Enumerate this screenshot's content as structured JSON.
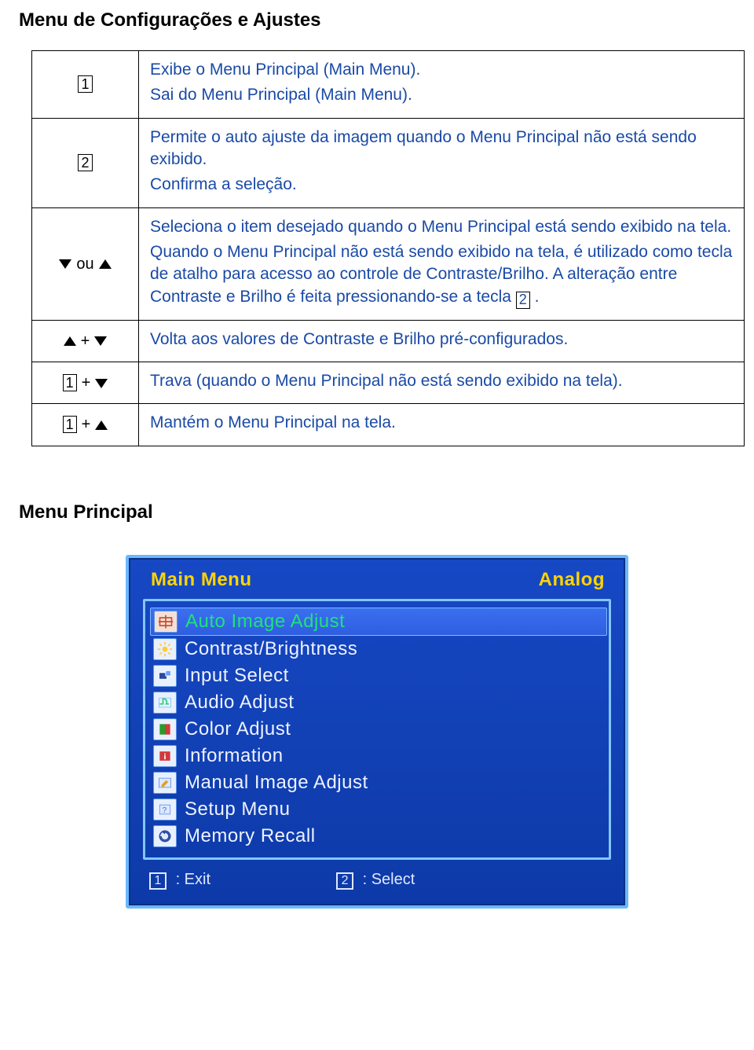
{
  "headings": {
    "config_menu": "Menu de Configurações e Ajustes",
    "main_menu": "Menu Principal"
  },
  "keytable": {
    "rows": [
      {
        "key_kind": "box",
        "key": "1",
        "lines": [
          "Exibe o Menu Principal (Main Menu).",
          "Sai do Menu Principal (Main Menu)."
        ]
      },
      {
        "key_kind": "box",
        "key": "2",
        "lines": [
          "Permite o auto ajuste da imagem quando o Menu Principal não está sendo exibido.",
          "Confirma a seleção."
        ]
      },
      {
        "key_kind": "down_ou_up",
        "ou_label": "ou",
        "lines": [
          "Seleciona o item desejado quando o Menu Principal está sendo exibido na tela.",
          "Quando o Menu Principal não está sendo exibido na tela, é utilizado como tecla de atalho para acesso ao controle de Contraste/Brilho. A alteração entre Contraste e Brilho é feita pressionando-se a tecla "
        ],
        "inline_key_after": "2",
        "inline_tail": " ."
      },
      {
        "key_kind": "up_plus_down",
        "lines": [
          "Volta aos valores de Contraste e Brilho pré-configurados."
        ]
      },
      {
        "key_kind": "box_plus_down",
        "key": "1",
        "lines": [
          "Trava (quando o Menu Principal não está sendo exibido na tela)."
        ]
      },
      {
        "key_kind": "box_plus_up",
        "key": "1",
        "lines": [
          "Mantém o Menu Principal na tela."
        ]
      }
    ]
  },
  "osd": {
    "header_left": "Main Menu",
    "header_right": "Analog",
    "items": [
      {
        "label": "Auto Image Adjust",
        "icon": "auto-image-icon",
        "selected": true
      },
      {
        "label": "Contrast/Brightness",
        "icon": "brightness-icon",
        "selected": false
      },
      {
        "label": "Input Select",
        "icon": "input-icon",
        "selected": false
      },
      {
        "label": "Audio Adjust",
        "icon": "audio-icon",
        "selected": false
      },
      {
        "label": "Color Adjust",
        "icon": "color-icon",
        "selected": false
      },
      {
        "label": "Information",
        "icon": "info-icon",
        "selected": false
      },
      {
        "label": "Manual Image Adjust",
        "icon": "wrench-icon",
        "selected": false
      },
      {
        "label": "Setup Menu",
        "icon": "setup-icon",
        "selected": false
      },
      {
        "label": "Memory Recall",
        "icon": "recall-icon",
        "selected": false
      }
    ],
    "footer": {
      "exit_key": "1",
      "exit_label": ": Exit",
      "select_key": "2",
      "select_label": ": Select"
    }
  }
}
